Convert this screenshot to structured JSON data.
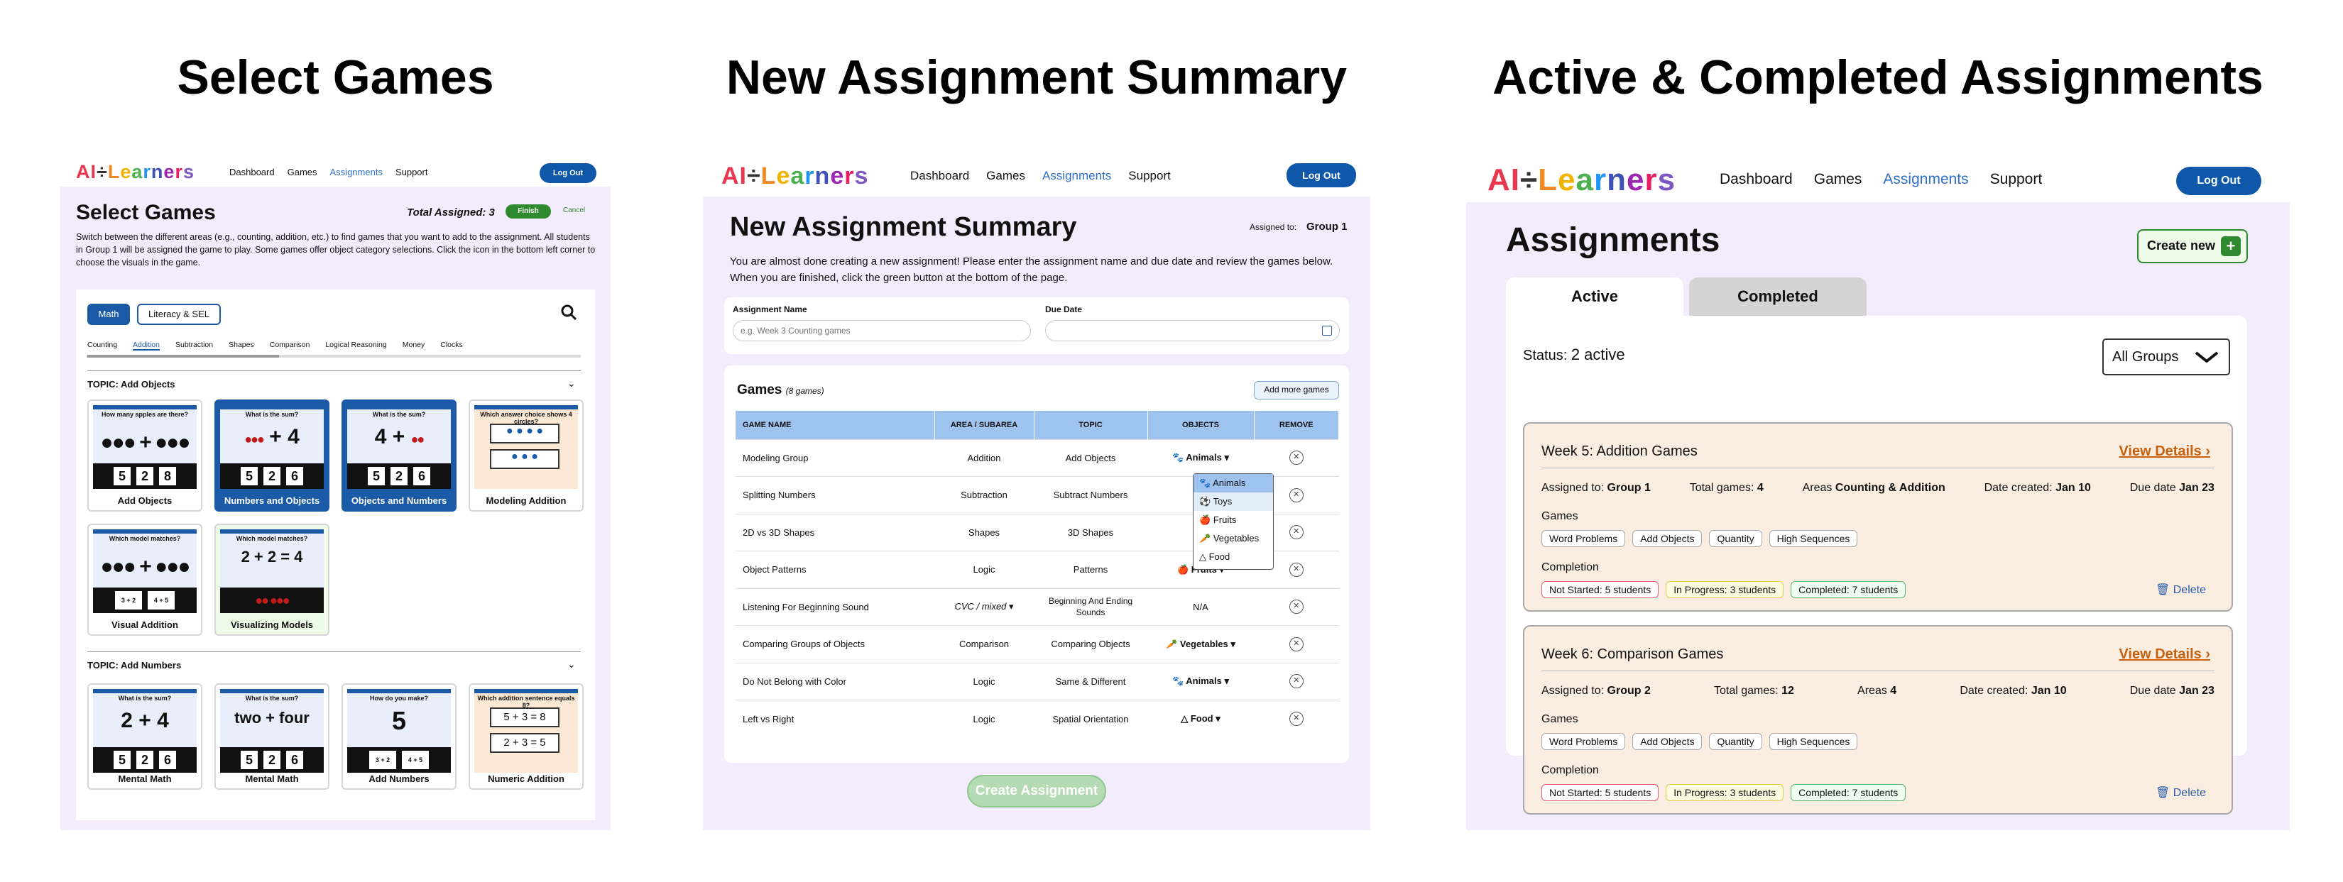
{
  "titles": {
    "left": "Select Games",
    "middle": "New Assignment Summary",
    "right": "Active & Completed Assignments"
  },
  "logo": {
    "parts": [
      "AI",
      "÷",
      "L",
      "e",
      "a",
      "r",
      "n",
      "e",
      "r",
      "s"
    ]
  },
  "nav": {
    "dashboard": "Dashboard",
    "games": "Games",
    "assignments": "Assignments",
    "support": "Support",
    "logout": "Log Out"
  },
  "select_games": {
    "heading": "Select Games",
    "total_assigned": "Total Assigned: 3",
    "finish": "Finish",
    "cancel": "Cancel",
    "description": "Switch between the different areas (e.g., counting, addition, etc.) to find games that you want to add to the assignment. All students in Group 1 will be assigned the game to play. Some games offer object category selections. Click the icon in the bottom left corner to choose the visuals in the game.",
    "area_tabs": [
      "Math",
      "Literacy & SEL"
    ],
    "subtabs": [
      "Counting",
      "Addition",
      "Subtraction",
      "Shapes",
      "Comparison",
      "Logical Reasoning",
      "Money",
      "Clocks"
    ],
    "topic1": "TOPIC: Add Objects",
    "topic2": "TOPIC: Add Numbers",
    "cards1": [
      {
        "label": "Add Objects",
        "question": "How many apples are there?"
      },
      {
        "label": "Numbers and Objects",
        "question": "What is the sum?"
      },
      {
        "label": "Objects and Numbers",
        "question": "What is the sum?"
      },
      {
        "label": "Modeling Addition",
        "question": "Which answer choice shows 4 circles?"
      }
    ],
    "cards2": [
      {
        "label": "Visual Addition",
        "question": "Which model matches?"
      },
      {
        "label": "Visualizing Models",
        "question": "Which model matches?",
        "eq": "2 + 2 = 4"
      }
    ],
    "cards3": [
      {
        "label": "Mental Math",
        "question": "What is the sum?",
        "big": "2  +  4"
      },
      {
        "label": "Mental Math",
        "question": "What is the sum?",
        "big": "two  +  four"
      },
      {
        "label": "Add Numbers",
        "question": "How do you make?",
        "big": "5"
      },
      {
        "label": "Numeric Addition",
        "question": "Which addition sentence equals 8?",
        "eq1": "5 + 3 = 8",
        "eq2": "2 + 3 = 5"
      }
    ],
    "answers": [
      "5",
      "2",
      "8"
    ],
    "answers2": [
      "5",
      "2",
      "6"
    ],
    "answers3": [
      "3 + 2",
      "4 + 5"
    ]
  },
  "summary": {
    "heading": "New Assignment Summary",
    "assigned_to_label": "Assigned to:",
    "assigned_to": "Group 1",
    "description": "You are almost done creating a new assignment! Please enter the assignment name and due date and review the games below. When you are finished, click the green button at the bottom of the page.",
    "name_label": "Assignment Name",
    "name_placeholder": "e.g. Week 3 Counting games",
    "due_label": "Due Date",
    "games_label": "Games",
    "games_count": "(8 games)",
    "add_more": "Add more games",
    "columns": [
      "GAME NAME",
      "AREA / SUBAREA",
      "TOPIC",
      "OBJECTS",
      "REMOVE"
    ],
    "rows": [
      [
        "Modeling Group",
        "Addition",
        "Add Objects",
        "Animals"
      ],
      [
        "Splitting Numbers",
        "Subtraction",
        "Subtract Numbers",
        ""
      ],
      [
        "2D vs 3D Shapes",
        "Shapes",
        "3D Shapes",
        ""
      ],
      [
        "Object Patterns",
        "Logic",
        "Patterns",
        "Fruits"
      ],
      [
        "Listening For Beginning Sound",
        "CVC / mixed",
        "Beginning And Ending Sounds",
        "N/A"
      ],
      [
        "Comparing Groups of Objects",
        "Comparison",
        "Comparing Objects",
        "Vegetables"
      ],
      [
        "Do Not Belong with Color",
        "Logic",
        "Same & Different",
        "Animals"
      ],
      [
        "Left vs Right",
        "Logic",
        "Spatial Orientation",
        "Food"
      ]
    ],
    "dropdown": [
      "Animals",
      "Toys",
      "Fruits",
      "Vegetables",
      "Food"
    ],
    "create": "Create Assignment"
  },
  "assignments": {
    "heading": "Assignments",
    "create_new": "Create new",
    "tabs": [
      "Active",
      "Completed"
    ],
    "status_label": "Status:",
    "status_value": "2 active",
    "group_select": "All Groups",
    "games_label": "Games",
    "completion_label": "Completion",
    "delete": "Delete",
    "view": "View Details",
    "chips": [
      "Word Problems",
      "Add Objects",
      "Quantity",
      "High Sequences"
    ],
    "status_chips": [
      "Not Started: 5 students",
      "In Progress: 3 students",
      "Completed: 7 students"
    ],
    "cards": [
      {
        "title": "Week 5: Addition Games",
        "assigned": "Group 1",
        "total": "4",
        "areas": "Counting & Addition",
        "created": "Jan 10",
        "due": "Jan 23"
      },
      {
        "title": "Week 6: Comparison Games",
        "assigned": "Group 2",
        "total": "12",
        "areas": "4",
        "created": "Jan 10",
        "due": "Jan 23"
      }
    ],
    "labels": {
      "assigned": "Assigned to:",
      "total": "Total games:",
      "areas": "Areas",
      "created": "Date created:",
      "due": "Due date"
    }
  },
  "colors": {
    "brand_blue": "#0f57a8",
    "lavender": "#f3ecfd",
    "finish_green": "#2f8a2f",
    "link_orange": "#c8600d"
  }
}
